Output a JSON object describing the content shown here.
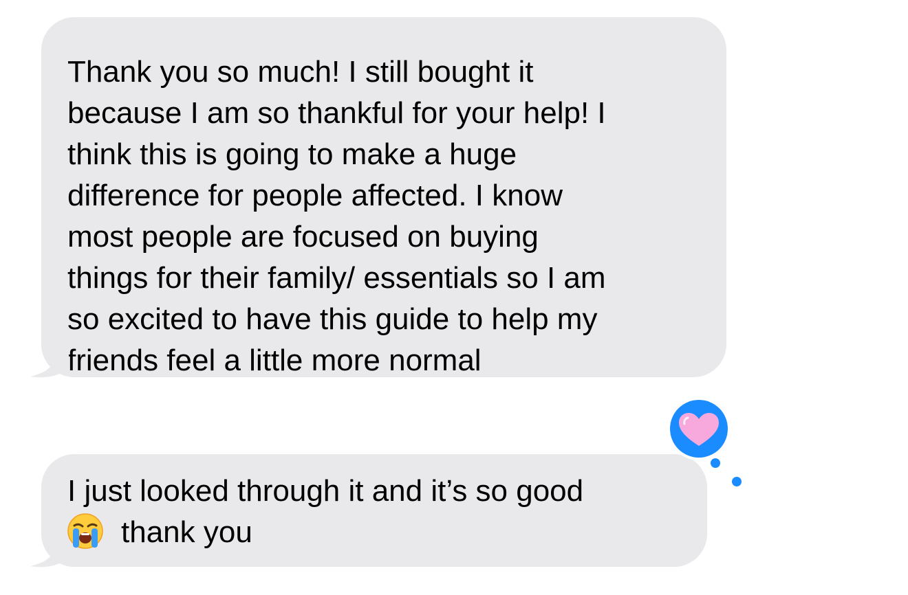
{
  "conversation": {
    "messages": [
      {
        "direction": "incoming",
        "text": "Thank you so much! I still bought it\nbecause I am so thankful for your help! I\nthink this is going to make a huge\ndifference for people affected. I know\nmost people are focused on buying\nthings for their family/ essentials so I am\nso excited to have this guide to help my\nfriends feel a little more normal"
      },
      {
        "direction": "incoming",
        "text_line1": "I just looked through it and it’s so good",
        "text_line2": "thank you",
        "emoji": "loudly-crying-face-icon",
        "reaction": {
          "icon": "pink-heart-icon",
          "badge_color": "#1a8cff",
          "heart_color": "#f5a0d6"
        }
      }
    ]
  },
  "colors": {
    "bubble_incoming": "#e9e9eb",
    "text": "#000000",
    "background": "#ffffff"
  }
}
